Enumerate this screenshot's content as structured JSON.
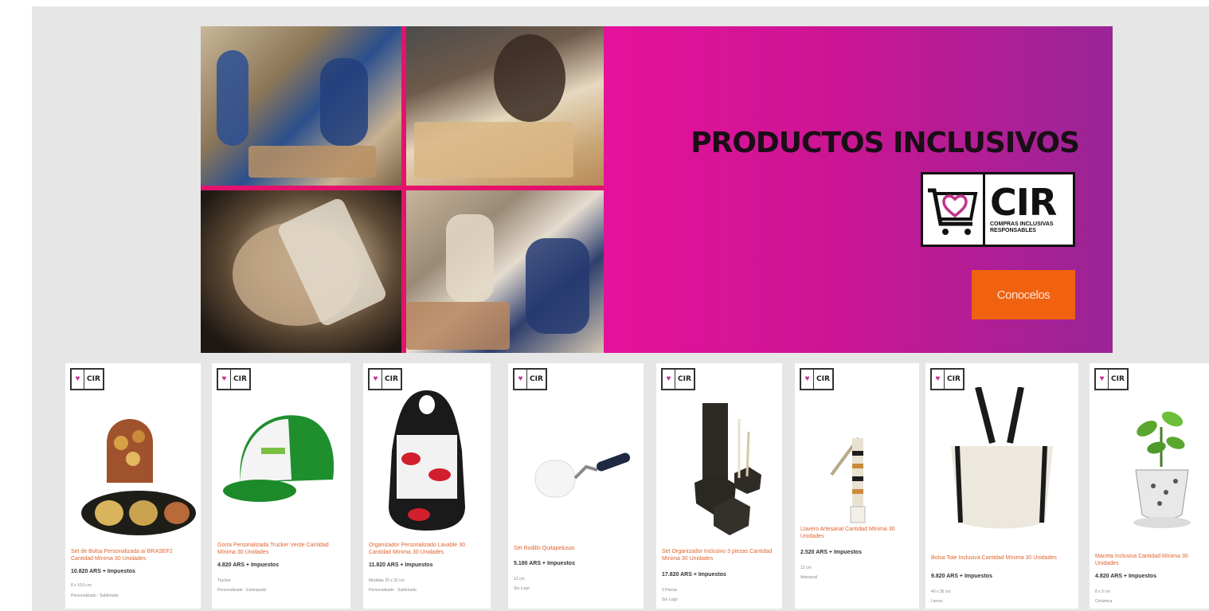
{
  "promo": {
    "title": "PRODUCTOS INCLUSIVOS",
    "logo_text": "CIR",
    "logo_subtitle": "COMPRAS INCLUSIVAS RESPONSABLES",
    "cta_label": "Conocelos",
    "colors": {
      "magenta": "#e5129a",
      "purple": "#9a2596",
      "cta": "#f06210",
      "frame": "#e5126d"
    }
  },
  "badge": {
    "text": "CIR"
  },
  "products": [
    {
      "name": "Set de Bolsa Personalizada a/ BRASEF2 Cantidad Mínima 30 Unidades",
      "price": "10.820 ARS + Impuestos",
      "meta1": "8 x 10,5 cm",
      "meta2": "Personalizado · Sublimado"
    },
    {
      "name": "Gorra Personalizada Trucker Verde Cantidad Mínima 30 Unidades",
      "price": "4.820 ARS + Impuestos",
      "meta1": "Trucker",
      "meta2": "Personalizado · Estampado"
    },
    {
      "name": "Organizador Personalizado Lavable 30 Cantidad Mínima 30 Unidades",
      "price": "11.820 ARS + Impuestos",
      "meta1": "Medidas 25 x 32 cm",
      "meta2": "Personalizado · Sublimado"
    },
    {
      "name": "Set Rodillo Quitapelusas",
      "price": "5.180 ARS + Impuestos",
      "meta1": "12 cm",
      "meta2": "Sin Logo"
    },
    {
      "name": "Set Organizador Inclusivo 3 piezas Cantidad Mínima 30 Unidades",
      "price": "17.820 ARS + Impuestos",
      "meta1": "3 Piezas",
      "meta2": "Sin Logo"
    },
    {
      "name": "Llavero Artesanal Cantidad Mínima 30 Unidades",
      "price": "2.520 ARS + Impuestos",
      "meta1": "12 cm",
      "meta2": "Artesanal"
    },
    {
      "name": "Bolsa Tote Inclusiva Cantidad Mínima 30 Unidades",
      "price": "9.820 ARS + Impuestos",
      "meta1": "40 x 36 cm",
      "meta2": "Lienzo"
    },
    {
      "name": "Maceta Inclusiva Cantidad Mínima 30 Unidades",
      "price": "4.820 ARS + Impuestos",
      "meta1": "8 x 9 cm",
      "meta2": "Cerámica"
    }
  ]
}
